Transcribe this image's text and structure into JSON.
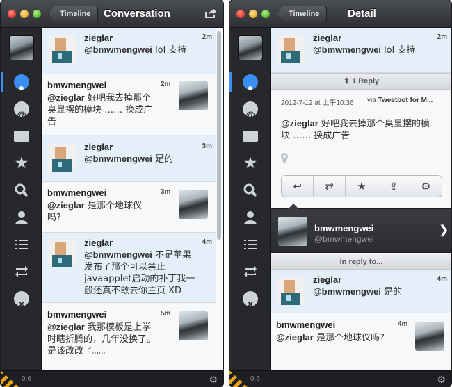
{
  "left_window": {
    "back_label": "Timeline",
    "title": "Conversation",
    "version": "0.6",
    "tweets": [
      {
        "name": "zieglar",
        "time": "2m",
        "mention": "@bmwmengwei",
        "text_lines": [
          "lol 支持"
        ]
      },
      {
        "name": "bmwmengwei",
        "time": "2m",
        "mention": "@zieglar",
        "text_lines": [
          "好吧我去掉那个",
          "臭显摆的模块 …… 换成广",
          "告"
        ]
      },
      {
        "name": "zieglar",
        "time": "3m",
        "mention": "@bmwmengwei",
        "text_lines": [
          "是的"
        ]
      },
      {
        "name": "bmwmengwei",
        "time": "3m",
        "mention": "@zieglar",
        "text_lines": [
          "是那个地球仪",
          "吗?"
        ]
      },
      {
        "name": "zieglar",
        "time": "4m",
        "mention": "@bmwmengwei",
        "text_lines": [
          "不是苹果",
          "发布了那个可以禁止",
          "javaapplet启动的补丁我一",
          "般还真不敢去你主页 XD"
        ]
      },
      {
        "name": "bmwmengwei",
        "time": "5m",
        "mention": "@zieglar",
        "text_lines": [
          "我那模板是上学",
          "时瞎折腾的，几年没换了。",
          "是该改改了。。。"
        ]
      }
    ]
  },
  "right_window": {
    "back_label": "Timeline",
    "title": "Detail",
    "version": "0.6",
    "top_tweet": {
      "name": "zieglar",
      "time": "2m",
      "mention": "@bmwmengwei",
      "text": "lol 支持"
    },
    "reply_bar": "1 Reply",
    "date": "2012-7-12 at 上午10:36",
    "via_prefix": "via",
    "via_app": "Tweetbot for M...",
    "detail_mention": "@zieglar",
    "detail_lines": [
      "好吧我去掉那个臭显摆的模",
      "块 …… 换成广告"
    ],
    "user": {
      "name": "bmwmengwei",
      "handle": "@bmwmengwei"
    },
    "in_reply_to": "In reply to...",
    "reply_tweets": [
      {
        "name": "zieglar",
        "time": "4m",
        "mention": "@bmwmengwei",
        "text": "是的"
      },
      {
        "name": "bmwmengwei",
        "time": "4m",
        "mention": "@zieglar",
        "text": "是那个地球仪吗?"
      }
    ]
  },
  "icons": {
    "sidebar": [
      "speech-bubble",
      "at-sign",
      "envelope",
      "star",
      "magnifier",
      "person",
      "list",
      "retweet",
      "mute"
    ],
    "actions": [
      "reply",
      "retweet",
      "favorite",
      "share",
      "settings"
    ]
  },
  "colors": {
    "accent_blue": "#3b8ff3",
    "highlight_row": "#e4effa",
    "window_dark": "#2a2c30",
    "hazard_orange": "#e8a317"
  }
}
